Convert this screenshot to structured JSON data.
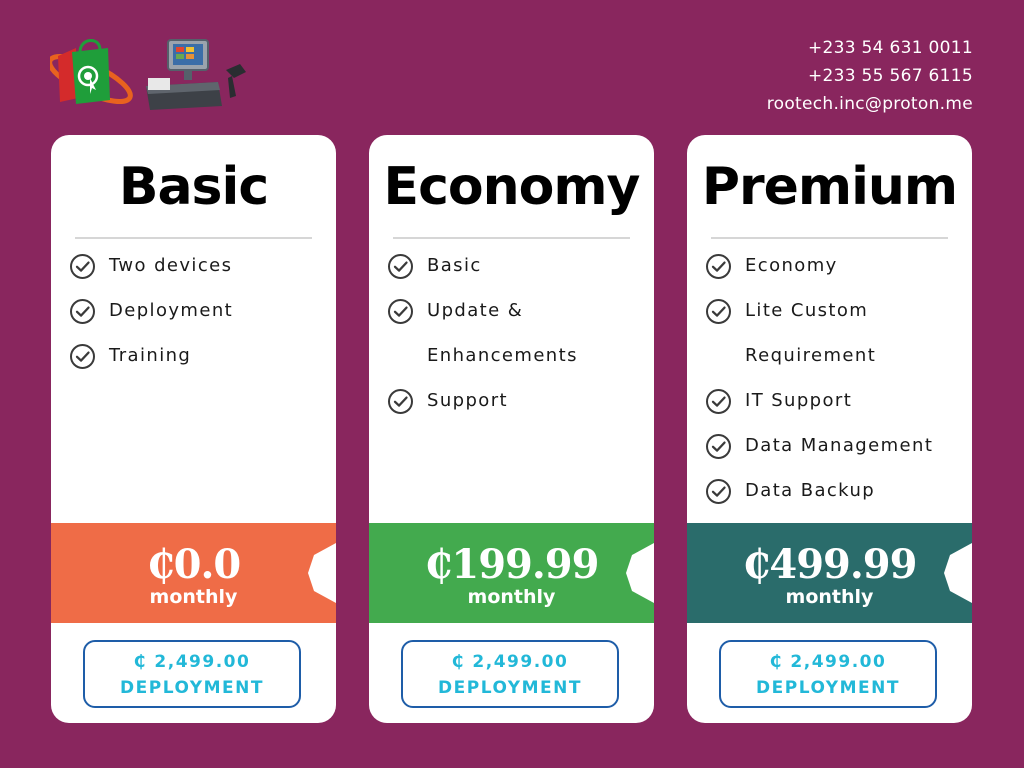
{
  "header": {
    "logos": [
      "shopping-bag-logo",
      "pos-terminal-logo"
    ],
    "contact": {
      "phone1": "+233 54 631 0011",
      "phone2": "+233 55 567 6115",
      "email": "rootech.inc@proton.me"
    }
  },
  "plans": [
    {
      "name": "Basic",
      "features": [
        "Two devices",
        "Deployment",
        "Training"
      ],
      "price": "₵0.0",
      "period": "monthly",
      "band_color": "#ef6c47",
      "deployment_price": "₵ 2,499.00",
      "deployment_label": "DEPLOYMENT"
    },
    {
      "name": "Economy",
      "features": [
        "Basic",
        "Update & Enhancements",
        "Support"
      ],
      "price": "₵199.99",
      "period": "monthly",
      "band_color": "#43aa4e",
      "deployment_price": "₵ 2,499.00",
      "deployment_label": "DEPLOYMENT"
    },
    {
      "name": "Premium",
      "features": [
        "Economy",
        "Lite Custom Requirement",
        "IT Support",
        "Data Management",
        "Data Backup"
      ],
      "price": "₵499.99",
      "period": "monthly",
      "band_color": "#2a6c6b",
      "deployment_price": "₵ 2,499.00",
      "deployment_label": "DEPLOYMENT"
    }
  ],
  "colors": {
    "background": "#89265e",
    "card": "#ffffff",
    "button_border": "#1e5da8",
    "button_text": "#22b8d8",
    "check": "#3a3a3a"
  }
}
